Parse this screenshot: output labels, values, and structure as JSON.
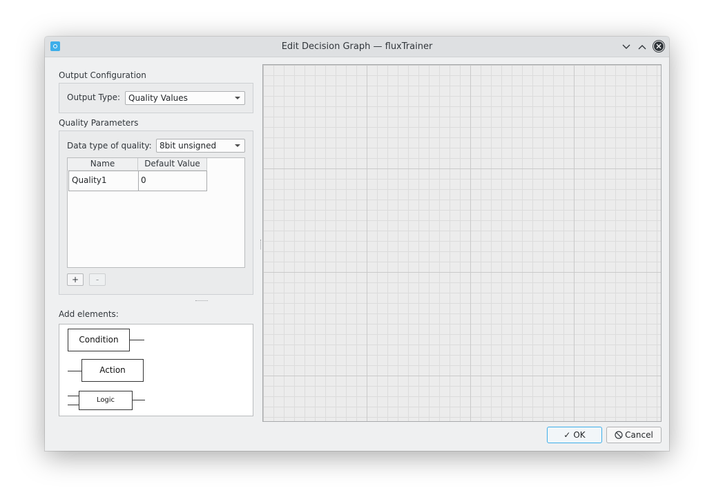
{
  "window": {
    "title": "Edit Decision Graph — fluxTrainer"
  },
  "output_config": {
    "section_label": "Output Configuration",
    "output_type_label": "Output Type:",
    "output_type_value": "Quality Values"
  },
  "quality_params": {
    "section_label": "Quality Parameters",
    "data_type_label": "Data type of quality:",
    "data_type_value": "8bit unsigned",
    "table": {
      "headers": [
        "Name",
        "Default Value"
      ],
      "rows": [
        {
          "name": "Quality1",
          "default_value": "0"
        }
      ]
    },
    "add_label": "+",
    "remove_label": "-"
  },
  "add_elements": {
    "section_label": "Add elements:",
    "items": [
      "Condition",
      "Action",
      "Logic"
    ]
  },
  "buttons": {
    "ok_icon": "✓",
    "ok_label": "OK",
    "cancel_icon": "⃠",
    "cancel_label": "Cancel"
  },
  "icons": {
    "app": "app-icon",
    "minimize": "chevron-down-icon",
    "maximize": "chevron-up-icon",
    "close": "close-icon"
  }
}
